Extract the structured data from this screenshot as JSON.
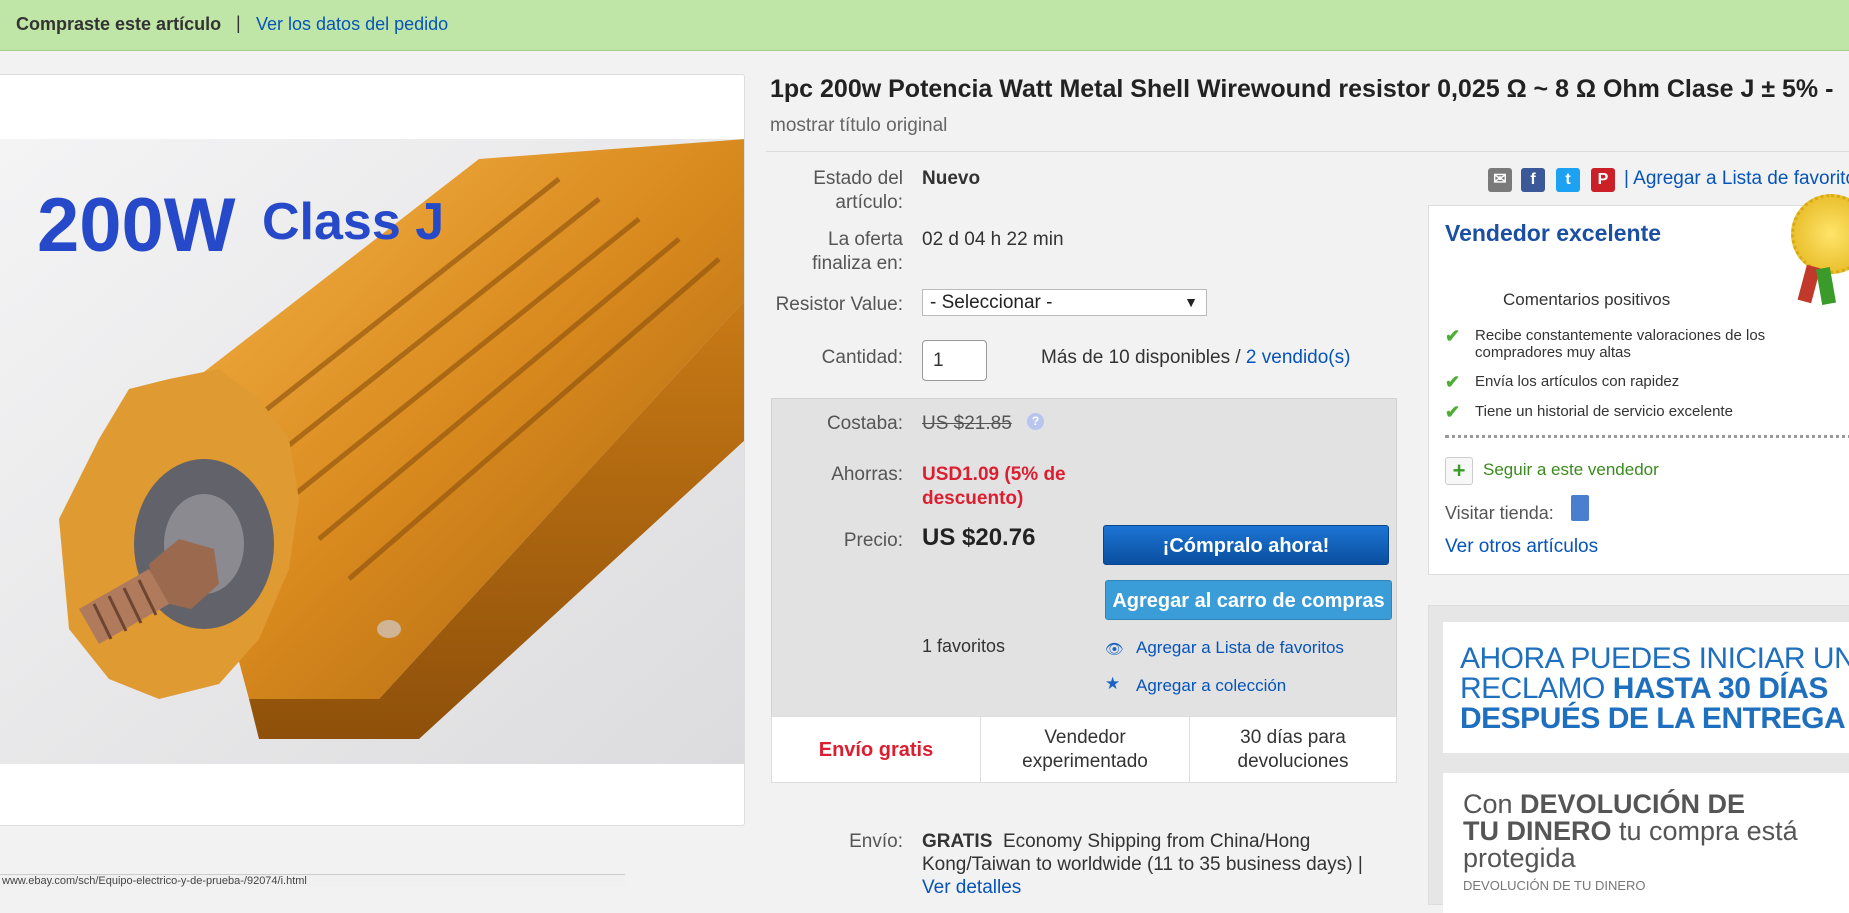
{
  "topbar": {
    "bought_text": "Compraste este artículo",
    "separator": "|",
    "order_link": "Ver los datos del pedido"
  },
  "product": {
    "image_text_big": "200W",
    "image_text_small": "Class J",
    "title": "1pc 200w Potencia Watt Metal Shell Wirewound resistor 0,025 Ω ~ 8 Ω Ohm Clase J ± 5% -",
    "title_original_link": "mostrar título original"
  },
  "details": {
    "condition_label_1": "Estado del",
    "condition_label_2": "artículo:",
    "condition_value": "Nuevo",
    "ends_label_1": "La oferta",
    "ends_label_2": "finaliza en:",
    "ends_value": "02 d 04 h 22 min",
    "resistor_label": "Resistor Value:",
    "resistor_selected": "- Seleccionar -",
    "qty_label": "Cantidad:",
    "qty_value": "1",
    "available_text": "Más de 10 disponibles /",
    "sold_link": "2 vendido(s)"
  },
  "pricing": {
    "was_label": "Costaba:",
    "was_value": "US $21.85",
    "help_icon": "?",
    "save_label": "Ahorras:",
    "save_value_1": "USD1.09 (5% de",
    "save_value_2": "descuento)",
    "price_label": "Precio:",
    "price_value": "US $20.76",
    "buy_now": "¡Cómpralo ahora!",
    "add_cart": "Agregar al carro de compras",
    "watchers": "1 favoritos",
    "add_watchlist": "Agregar a Lista de favoritos",
    "add_collection": "Agregar a colección"
  },
  "badges": {
    "free_shipping": "Envío gratis",
    "seller_1": "Vendedor",
    "seller_2": "experimentado",
    "returns_1": "30 días para",
    "returns_2": "devoluciones"
  },
  "shipping": {
    "label": "Envío:",
    "free": "GRATIS",
    "desc_1": "Economy Shipping from China/Hong",
    "desc_2": "Kong/Taiwan to worldwide (11 to 35 business days) |",
    "desc_3": "Ver detalles"
  },
  "share": {
    "watch_link": "| Agregar a Lista de favoritos"
  },
  "seller": {
    "heading": "Vendedor excelente",
    "feedback": "Comentarios positivos",
    "bullet_1a": "Recibe constantemente valoraciones de los",
    "bullet_1b": "compradores muy altas",
    "bullet_2": "Envía los artículos con rapidez",
    "bullet_3": "Tiene un historial de servicio excelente",
    "follow": "Seguir a este vendedor",
    "visit_store": "Visitar tienda:",
    "other_items": "Ver otros artículos"
  },
  "promo": {
    "claim_1": "AHORA PUEDES INICIAR UN",
    "claim_2a": "RECLAMO",
    "claim_2b": "HASTA 30 DÍAS",
    "claim_3": "DESPUÉS DE LA ENTREGA",
    "mb_1a": "Con",
    "mb_1b": "DEVOLUCIÓN DE",
    "mb_2a": "TU DINERO",
    "mb_2b": "tu compra está",
    "mb_3": "protegida",
    "mb_4": "DEVOLUCIÓN DE TU DINERO"
  },
  "statusbar": {
    "url": "www.ebay.com/sch/Equipo-electrico-y-de-prueba-/92074/i.html"
  },
  "colors": {
    "topbar_bg": "#bfe6a7",
    "link": "#0654ba",
    "save_red": "#dd1e31",
    "buy_blue": "#0f5ab5",
    "cart_blue": "#3a9dd8"
  }
}
